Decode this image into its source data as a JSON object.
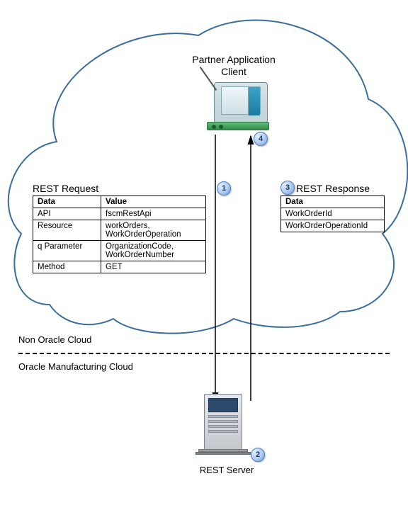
{
  "title_line1": "Partner Application",
  "title_line2": "Client",
  "request_label": "REST Request",
  "response_label": "REST Response",
  "request_table": {
    "headers": [
      "Data",
      "Value"
    ],
    "rows": [
      [
        "API",
        "fscmRestApi"
      ],
      [
        "Resource",
        "workOrders,\nWorkOrderOperation"
      ],
      [
        "q Parameter",
        "OrganizationCode,\nWorkOrderNumber"
      ],
      [
        "Method",
        "GET"
      ]
    ]
  },
  "response_table": {
    "header": "Data",
    "rows": [
      "WorkOrderId",
      "WorkOrderOperationId"
    ]
  },
  "section_upper": "Non Oracle Cloud",
  "section_lower": "Oracle Manufacturing Cloud",
  "server_label": "REST Server",
  "callouts": {
    "c1": "1",
    "c2": "2",
    "c3": "3",
    "c4": "4"
  }
}
